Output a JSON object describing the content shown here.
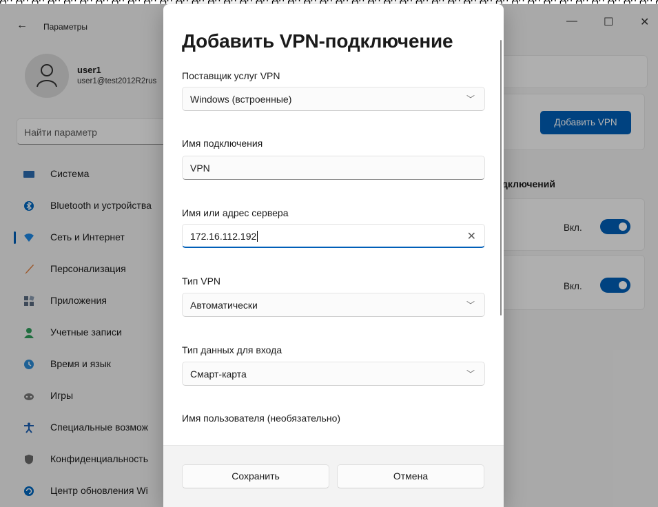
{
  "window": {
    "title": "Параметры",
    "back_icon": "←",
    "controls": {
      "minimize": "—",
      "maximize": "☐",
      "close": "✕"
    }
  },
  "account": {
    "name": "user1",
    "email": "user1@test2012R2rus"
  },
  "search": {
    "placeholder": "Найти параметр"
  },
  "sidebar": {
    "items": [
      {
        "label": "Система",
        "icon": "system-icon",
        "color": "#2b6cb0"
      },
      {
        "label": "Bluetooth и устройства",
        "icon": "bluetooth-icon",
        "color": "#0067c0"
      },
      {
        "label": "Сеть и Интернет",
        "icon": "wifi-icon",
        "color": "#1e88e5",
        "active": true
      },
      {
        "label": "Персонализация",
        "icon": "brush-icon",
        "color": "#e07b39"
      },
      {
        "label": "Приложения",
        "icon": "apps-icon",
        "color": "#5a6b80"
      },
      {
        "label": "Учетные записи",
        "icon": "person-icon",
        "color": "#2e9e5b"
      },
      {
        "label": "Время и язык",
        "icon": "globe-clock-icon",
        "color": "#2b8bd6"
      },
      {
        "label": "Игры",
        "icon": "gamepad-icon",
        "color": "#7a7a7a"
      },
      {
        "label": "Специальные возмож",
        "icon": "accessibility-icon",
        "color": "#1a5fb4"
      },
      {
        "label": "Конфиденциальность",
        "icon": "shield-icon",
        "color": "#6a6a6a"
      },
      {
        "label": "Центр обновления Wi",
        "icon": "update-icon",
        "color": "#0067c0"
      }
    ]
  },
  "main": {
    "add_vpn_label": "Добавить VPN",
    "section_heading": "дключений",
    "toggles": [
      {
        "label": "Вкл.",
        "on": true
      },
      {
        "label": "Вкл.",
        "on": true
      }
    ]
  },
  "dialog": {
    "title": "Добавить VPN-подключение",
    "provider_label": "Поставщик услуг VPN",
    "provider_value": "Windows (встроенные)",
    "conn_name_label": "Имя подключения",
    "conn_name_value": "VPN",
    "server_label": "Имя или адрес сервера",
    "server_value": "172.16.112.192",
    "vpn_type_label": "Тип VPN",
    "vpn_type_value": "Автоматически",
    "signin_type_label": "Тип данных для входа",
    "signin_type_value": "Смарт-карта",
    "username_label": "Имя пользователя (необязательно)",
    "save_label": "Сохранить",
    "cancel_label": "Отмена"
  },
  "colors": {
    "accent": "#005fb8"
  }
}
